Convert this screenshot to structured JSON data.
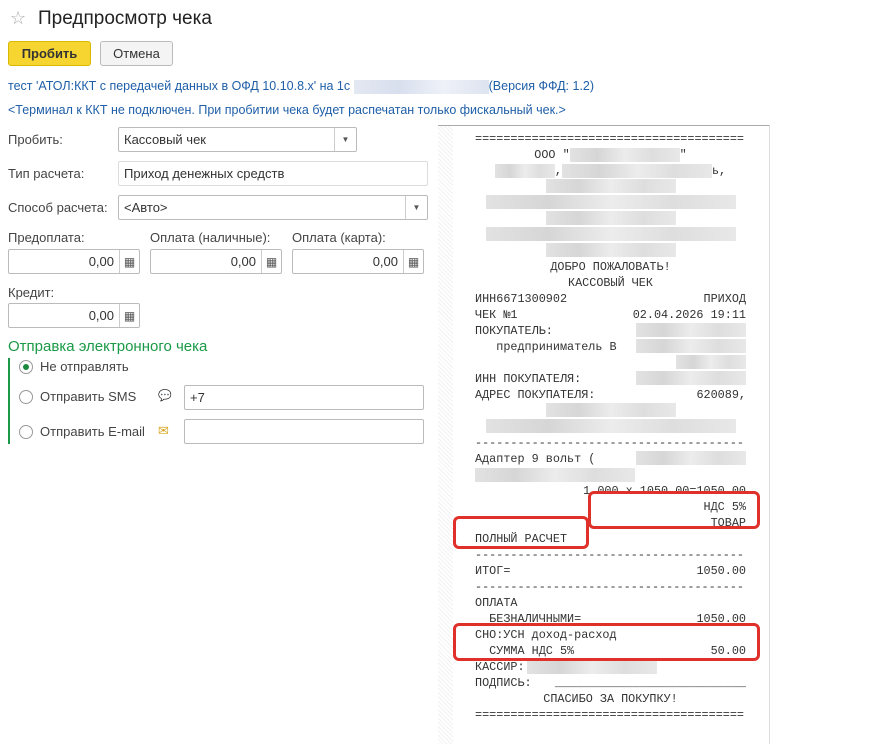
{
  "window": {
    "title": "Предпросмотр чека"
  },
  "toolbar": {
    "print_label": "Пробить",
    "cancel_label": "Отмена"
  },
  "info": {
    "device_prefix": "тест 'АТОЛ:ККТ с передачей данных в ОФД 10.10.8.x' на 1с",
    "ffd_version": "(Версия ФФД: 1.2)",
    "terminal_notice": "<Терминал к ККТ не подключен. При пробитии чека будет распечатан только фискальный чек.>"
  },
  "form": {
    "print_label": "Пробить:",
    "print_value": "Кассовый чек",
    "calc_type_label": "Тип расчета:",
    "calc_type_value": "Приход денежных средств",
    "method_label": "Способ расчета:",
    "method_value": "<Авто>",
    "prepay_label": "Предоплата:",
    "prepay_value": "0,00",
    "cash_label": "Оплата (наличные):",
    "cash_value": "0,00",
    "card_label": "Оплата (карта):",
    "card_value": "0,00",
    "credit_label": "Кредит:",
    "credit_value": "0,00"
  },
  "ereceipt": {
    "title": "Отправка электронного чека",
    "opt_none": "Не отправлять",
    "opt_sms": "Отправить SMS",
    "opt_email": "Отправить E-mail",
    "sms_value": "+7",
    "email_value": "",
    "selected": "none"
  },
  "receipt": {
    "lines": [
      {
        "l": "======================================"
      },
      {
        "c": "ООО \"",
        "blur": 110,
        "c2": "\""
      },
      {
        "blur0": 60,
        "c": ",",
        "blur": 150,
        "c2": "ь,"
      },
      {
        "blurfull": true
      },
      {
        "blurfull": true
      },
      {
        "blurfull": true
      },
      {
        "blurfull": true
      },
      {
        "blurfull": true
      },
      {
        "c": "ДОБРО ПОЖАЛОВАТЬ!"
      },
      {
        "c": "КАССОВЫЙ ЧЕК"
      },
      {
        "l": "ИНН6671300902",
        "r": "ПРИХОД"
      },
      {
        "l": "ЧЕК №1",
        "r": "02.04.2026 19:11"
      },
      {
        "l": "ПОКУПАТЕЛЬ:",
        "rblur": 110
      },
      {
        "l": "   предприниматель В",
        "rblur": 110
      },
      {
        "rblur": 70
      },
      {
        "l": "ИНН ПОКУПАТЕЛЯ:",
        "rblur": 110
      },
      {
        "l": "АДРЕС ПОКУПАТЕЛЯ:",
        "r": "620089,"
      },
      {
        "blurfull": true
      },
      {
        "blurfull": true
      },
      {
        "l": "--------------------------------------"
      },
      {
        "l": "Адаптер 9 вольт (",
        "rblur": 110
      },
      {
        "blur0": 160
      },
      {
        "r": "1.000 x 1050.00=1050.00"
      },
      {
        "r": "НДС 5%"
      },
      {
        "r": "ТОВАР"
      },
      {
        "l": "ПОЛНЫЙ РАСЧЕТ"
      },
      {
        "l": "--------------------------------------"
      },
      {
        "l": "ИТОГ=",
        "r": "1050.00"
      },
      {
        "l": "--------------------------------------"
      },
      {
        "l": "ОПЛАТА"
      },
      {
        "l": "  БЕЗНАЛИЧНЫМИ=",
        "r": "1050.00"
      },
      {
        "l": "СНО:УСН доход-расход"
      },
      {
        "l": "  СУММА НДС 5%",
        "r": "50.00"
      },
      {
        "l": "КАССИР:",
        "blurafter": 130
      },
      {
        "l": "ПОДПИСЬ:",
        "r": "___________________________"
      },
      {
        "c": "СПАСИБО ЗА ПОКУПКУ!"
      },
      {
        "l": "======================================"
      }
    ]
  },
  "colors": {
    "accent": "#f7d530",
    "section": "#1a9a46",
    "link": "#1f5fa8",
    "highlight": "#e0302a"
  }
}
